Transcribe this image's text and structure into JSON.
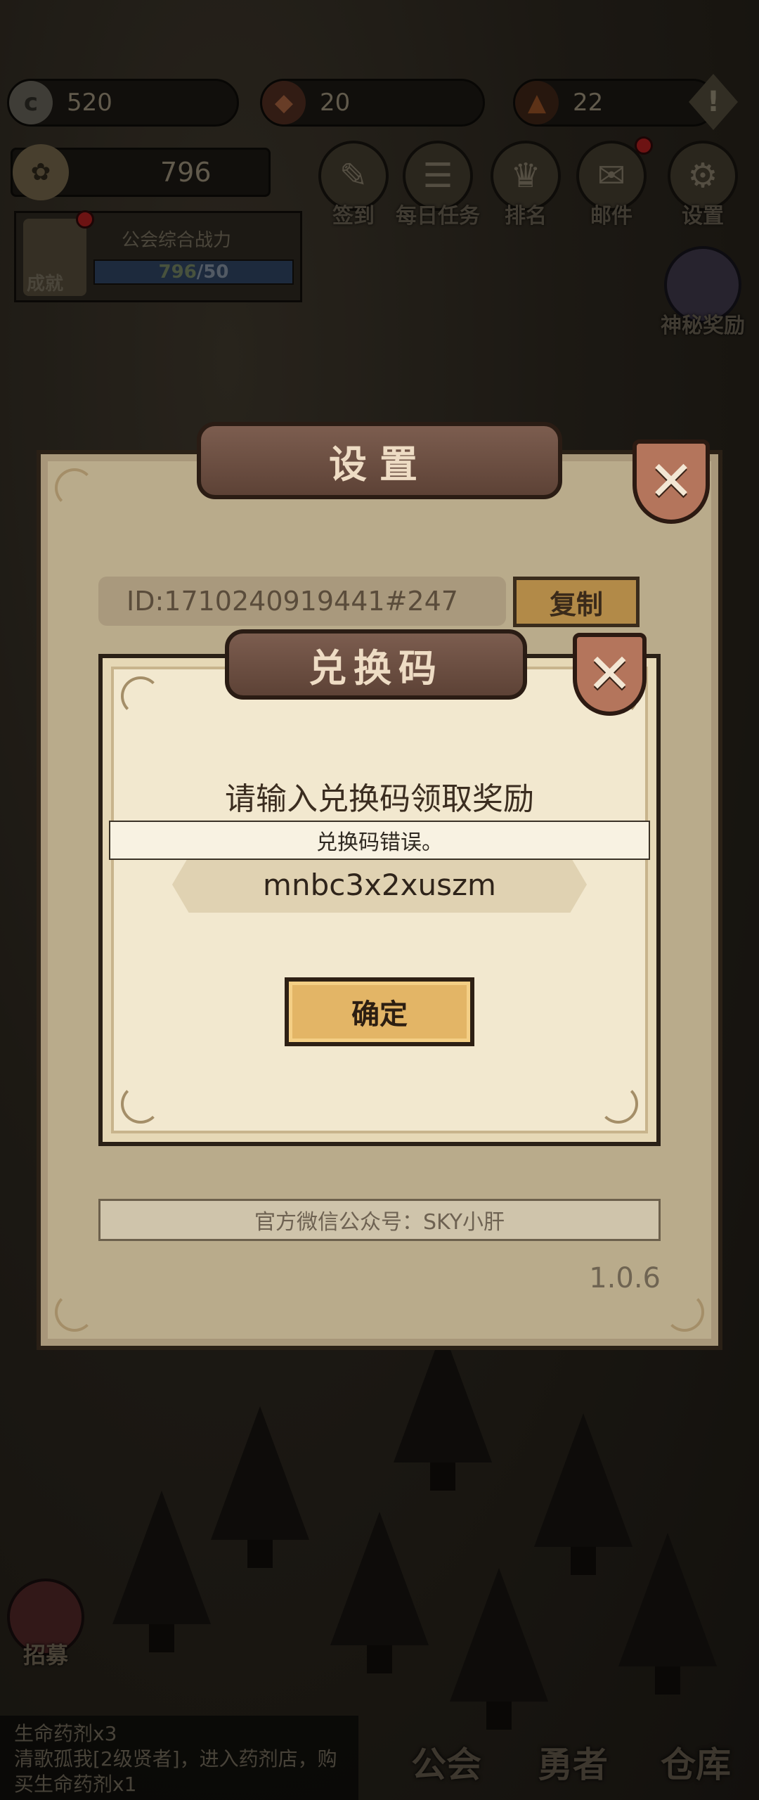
{
  "hud": {
    "coins": "520",
    "shield_currency": "20",
    "energy": "22",
    "alert": "!",
    "power": "796"
  },
  "guild": {
    "achievement_label": "成就",
    "title": "公会综合战力",
    "progress_current": "796",
    "progress_max": "/50"
  },
  "menu": [
    {
      "label": "签到",
      "icon": "pen-icon"
    },
    {
      "label": "每日任务",
      "icon": "scroll-icon"
    },
    {
      "label": "排名",
      "icon": "crown-icon"
    },
    {
      "label": "邮件",
      "icon": "mail-icon"
    },
    {
      "label": "设置",
      "icon": "gear-icon"
    }
  ],
  "mystery_reward": "神秘奖励",
  "settings": {
    "title": "设置",
    "player_id": "ID:1710240919441#247",
    "copy_label": "复制",
    "wechat": "官方微信公众号：SKY小肝",
    "version": "1.0.6"
  },
  "redeem": {
    "title": "兑换码",
    "prompt": "请输入兑换码领取奖励",
    "error_toast": "兑换码错误。",
    "code_value": "mnbc3x2xuszm",
    "confirm_label": "确定"
  },
  "recruit_label": "招募",
  "log_lines": [
    "生命药剂x3",
    "清歌孤我[2级贤者]，进入药剂店，购",
    "买生命药剂x1"
  ],
  "nav": [
    {
      "label": "公会"
    },
    {
      "label": "勇者"
    },
    {
      "label": "仓库"
    }
  ]
}
